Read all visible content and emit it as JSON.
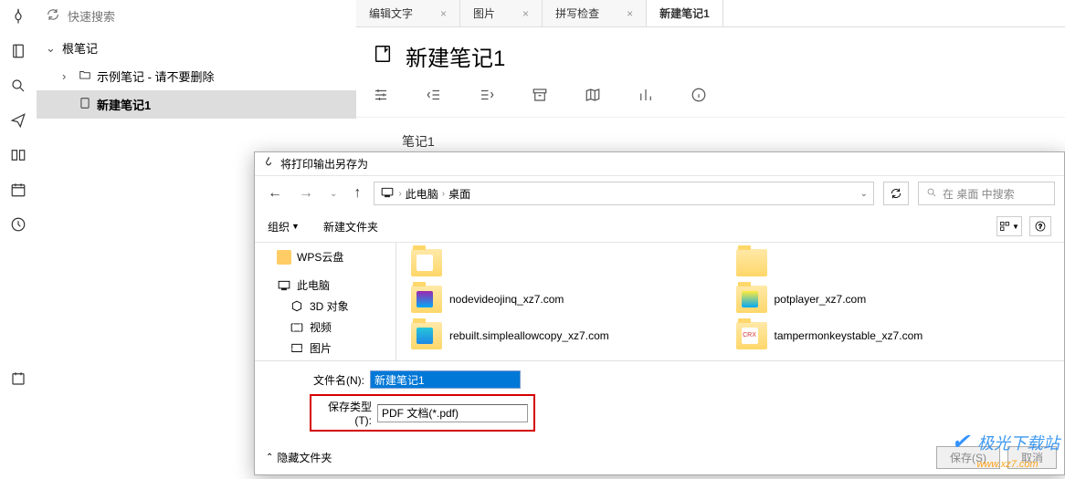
{
  "search": {
    "placeholder": "快速搜索"
  },
  "tree": {
    "root": "根笔记",
    "item1": "示例笔记 - 请不要删除",
    "item2": "新建笔记1"
  },
  "tabs": [
    {
      "label": "编辑文字"
    },
    {
      "label": "图片"
    },
    {
      "label": "拼写检查"
    },
    {
      "label": "新建笔记1"
    }
  ],
  "doc": {
    "title": "新建笔记1",
    "content": "笔记1"
  },
  "dialog": {
    "title": "将打印输出另存为",
    "path": {
      "seg1": "此电脑",
      "seg2": "桌面"
    },
    "search_placeholder": "在 桌面 中搜索",
    "toolbar": {
      "organize": "组织",
      "new_folder": "新建文件夹"
    },
    "side": {
      "wps": "WPS云盘",
      "thispc": "此电脑",
      "objects3d": "3D 对象",
      "video": "视频",
      "pictures": "图片"
    },
    "files": [
      {
        "name": "nodevideojinq_xz7.com"
      },
      {
        "name": "potplayer_xz7.com"
      },
      {
        "name": "rebuilt.simpleallowcopy_xz7.com"
      },
      {
        "name": "tampermonkeystable_xz7.com"
      }
    ],
    "filename_label": "文件名(N):",
    "filename_value": "新建笔记1",
    "savetype_label": "保存类型(T):",
    "savetype_value": "PDF 文档(*.pdf)",
    "hide_folders": "隐藏文件夹",
    "save_btn": "保存(S)",
    "cancel_btn": "取消"
  },
  "watermark": {
    "line1": "极光下载站",
    "line2": "www.xz7.com"
  }
}
